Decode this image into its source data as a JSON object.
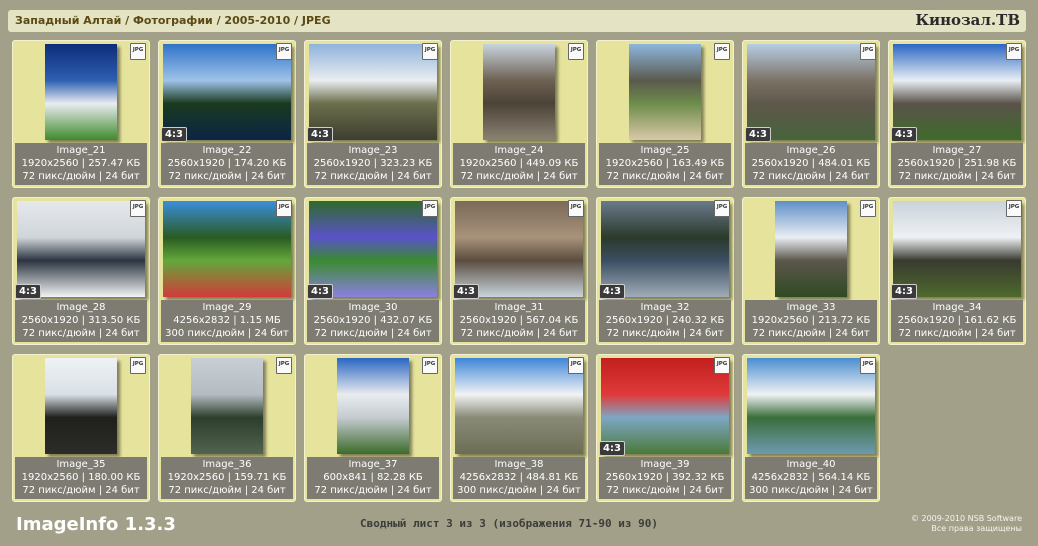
{
  "header": {
    "breadcrumb": "Западный Алтай / Фотографии / 2005-2010 / JPEG",
    "brand": "Кинозал.ТВ"
  },
  "file_badge": "JPG",
  "images": [
    {
      "name": "Image_21",
      "dims": "1920x2560 | 257.47 КБ",
      "res": "72 пикс/дюйм | 24 бит",
      "orientation": "portrait",
      "ratio": "",
      "colors": [
        "#0d2c7a",
        "#2e5fb2",
        "#e8ecf0",
        "#3f8a2c"
      ]
    },
    {
      "name": "Image_22",
      "dims": "2560x1920 | 174.20 КБ",
      "res": "72 пикс/дюйм | 24 бит",
      "orientation": "landscape",
      "ratio": "4:3",
      "colors": [
        "#2f73c9",
        "#9ec3e8",
        "#1a3a1f",
        "#0b2545"
      ]
    },
    {
      "name": "Image_23",
      "dims": "2560x1920 | 323.23 КБ",
      "res": "72 пикс/дюйм | 24 бит",
      "orientation": "landscape",
      "ratio": "4:3",
      "colors": [
        "#8fb3dc",
        "#e9edf0",
        "#6b6f4c",
        "#3d3e30"
      ]
    },
    {
      "name": "Image_24",
      "dims": "1920x2560 | 449.09 КБ",
      "res": "72 пикс/дюйм | 24 бит",
      "orientation": "portrait",
      "ratio": "",
      "colors": [
        "#c8d4de",
        "#6d6152",
        "#4c4338",
        "#8a8271"
      ]
    },
    {
      "name": "Image_25",
      "dims": "1920x2560 | 163.49 КБ",
      "res": "72 пикс/дюйм | 24 бит",
      "orientation": "portrait",
      "ratio": "",
      "colors": [
        "#8eb6de",
        "#5a5a4c",
        "#6d8c4a",
        "#d8c9a8"
      ]
    },
    {
      "name": "Image_26",
      "dims": "2560x1920 | 484.01 КБ",
      "res": "72 пикс/дюйм | 24 бит",
      "orientation": "landscape",
      "ratio": "4:3",
      "colors": [
        "#b7cde3",
        "#7b7265",
        "#5e574c",
        "#47643a"
      ]
    },
    {
      "name": "Image_27",
      "dims": "2560x1920 | 251.98 КБ",
      "res": "72 пикс/дюйм | 24 бит",
      "orientation": "landscape",
      "ratio": "4:3",
      "colors": [
        "#2b66c4",
        "#e8eef4",
        "#5a534a",
        "#3f6b2a"
      ]
    },
    {
      "name": "Image_28",
      "dims": "2560x1920 | 313.50 КБ",
      "res": "72 пикс/дюйм | 24 бит",
      "orientation": "landscape",
      "ratio": "4:3",
      "colors": [
        "#e6e9ec",
        "#cfd5da",
        "#2b3440",
        "#f2f4f5"
      ]
    },
    {
      "name": "Image_29",
      "dims": "4256x2832 | 1.15 МБ",
      "res": "300 пикс/дюйм | 24 бит",
      "orientation": "landscape",
      "ratio": "",
      "colors": [
        "#3a8fdc",
        "#2a5b22",
        "#63a83a",
        "#d23a3a"
      ]
    },
    {
      "name": "Image_30",
      "dims": "2560x1920 | 432.07 КБ",
      "res": "72 пикс/дюйм | 24 бит",
      "orientation": "landscape",
      "ratio": "4:3",
      "colors": [
        "#2f6b2a",
        "#5a52c9",
        "#3a8b30",
        "#8b80e0"
      ]
    },
    {
      "name": "Image_31",
      "dims": "2560x1920 | 567.04 КБ",
      "res": "72 пикс/дюйм | 24 бит",
      "orientation": "landscape",
      "ratio": "4:3",
      "colors": [
        "#7a6a58",
        "#a8927a",
        "#5b4d40",
        "#c9d4dc"
      ]
    },
    {
      "name": "Image_32",
      "dims": "2560x1920 | 240.32 КБ",
      "res": "72 пикс/дюйм | 24 бит",
      "orientation": "landscape",
      "ratio": "4:3",
      "colors": [
        "#6a7a8c",
        "#2b3a2a",
        "#3b4e62",
        "#a0acb8"
      ]
    },
    {
      "name": "Image_33",
      "dims": "1920x2560 | 213.72 КБ",
      "res": "72 пикс/дюйм | 24 бит",
      "orientation": "portrait",
      "ratio": "",
      "colors": [
        "#5f8fc8",
        "#e9eef3",
        "#5c574c",
        "#2f4a22"
      ]
    },
    {
      "name": "Image_34",
      "dims": "2560x1920 | 161.62 КБ",
      "res": "72 пикс/дюйм | 24 бит",
      "orientation": "landscape",
      "ratio": "4:3",
      "colors": [
        "#c9d2da",
        "#eef1f4",
        "#3a3a30",
        "#4d6a2c"
      ]
    },
    {
      "name": "Image_35",
      "dims": "1920x2560 | 180.00 КБ",
      "res": "72 пикс/дюйм | 24 бит",
      "orientation": "portrait",
      "ratio": "",
      "colors": [
        "#eef2f5",
        "#d9e0e6",
        "#1f1f1c",
        "#2c2c28"
      ]
    },
    {
      "name": "Image_36",
      "dims": "1920x2560 | 159.71 КБ",
      "res": "72 пикс/дюйм | 24 бит",
      "orientation": "portrait",
      "ratio": "",
      "colors": [
        "#c8d0d6",
        "#b4bcc2",
        "#2d3f2c",
        "#52634f"
      ]
    },
    {
      "name": "Image_37",
      "dims": "600x841 | 82.28 КБ",
      "res": "72 пикс/дюйм | 24 бит",
      "orientation": "portrait",
      "ratio": "",
      "colors": [
        "#2a66c2",
        "#e9ecee",
        "#c5cbd1",
        "#3c6b2a"
      ]
    },
    {
      "name": "Image_38",
      "dims": "4256x2832 | 484.81 КБ",
      "res": "300 пикс/дюйм | 24 бит",
      "orientation": "landscape",
      "ratio": "",
      "colors": [
        "#3e86d8",
        "#f1f3f4",
        "#8a8a78",
        "#6b6e54"
      ]
    },
    {
      "name": "Image_39",
      "dims": "2560x1920 | 392.32 КБ",
      "res": "72 пикс/дюйм | 24 бит",
      "orientation": "landscape",
      "ratio": "4:3",
      "colors": [
        "#c21f1f",
        "#e03a3a",
        "#7ea6c4",
        "#4a7a3a"
      ]
    },
    {
      "name": "Image_40",
      "dims": "4256x2832 | 564.14 КБ",
      "res": "300 пикс/дюйм | 24 бит",
      "orientation": "landscape",
      "ratio": "",
      "colors": [
        "#4a8ed0",
        "#f0f2f4",
        "#3a6e3a",
        "#6e9ab0"
      ]
    }
  ],
  "footer": {
    "logo": "ImageInfo 1.3.3",
    "summary": "Сводный лист 3 из 3 (изображения 71-90 из 90)",
    "copyright_line1": "© 2009-2010 NSB Software",
    "copyright_line2": "Все права защищены"
  }
}
